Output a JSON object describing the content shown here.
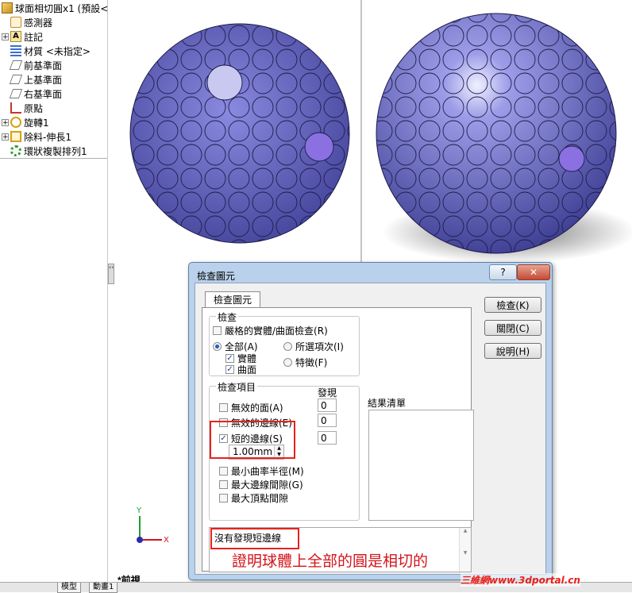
{
  "tree": {
    "items": [
      {
        "label": "球面相切圓x1 (預設<",
        "expander": ""
      },
      {
        "label": "感測器",
        "expander": ""
      },
      {
        "label": "註記",
        "expander": "+"
      },
      {
        "label": "材質 <未指定>",
        "expander": ""
      },
      {
        "label": "前基準面",
        "expander": ""
      },
      {
        "label": "上基準面",
        "expander": ""
      },
      {
        "label": "右基準面",
        "expander": ""
      },
      {
        "label": "原點",
        "expander": ""
      },
      {
        "label": "旋轉1",
        "expander": "+"
      },
      {
        "label": "除料-伸長1",
        "expander": "+"
      },
      {
        "label": "環狀複製排列1",
        "expander": ""
      }
    ],
    "bottom_tabs": [
      "模型",
      "動畫1"
    ]
  },
  "view": {
    "label": "*前視",
    "triad": {
      "x": "X",
      "y": "Y"
    },
    "sphere_color": "#5a5ab4",
    "sphere_highlight": "#c8c8f0"
  },
  "dialog": {
    "title": "檢查圖元",
    "help": "?",
    "close": "✕",
    "tab": "檢查圖元",
    "check_group": {
      "title": "檢查",
      "strict": {
        "label": "嚴格的實體/曲面檢查(R)",
        "checked": false
      },
      "all": {
        "label": "全部(A)",
        "selected": true
      },
      "solid": {
        "label": "實體",
        "checked": true
      },
      "surface": {
        "label": "曲面",
        "checked": true
      },
      "selected_items": {
        "label": "所選項次(I)",
        "selected": false
      },
      "feature": {
        "label": "特徵(F)",
        "selected": false
      }
    },
    "items_group": {
      "title": "檢查項目",
      "found_header": "發現",
      "items": [
        {
          "label": "無效的面(A)",
          "checked": false,
          "found": "0"
        },
        {
          "label": "無效的邊線(E)",
          "checked": false,
          "found": "0"
        },
        {
          "label": "短的邊線(S)",
          "checked": true,
          "found": "0"
        },
        {
          "label": "最小曲率半徑(M)",
          "checked": false
        },
        {
          "label": "最大邊線間隙(G)",
          "checked": false
        },
        {
          "label": "最大頂點間隙",
          "checked": false
        }
      ],
      "short_edge_value": "1.00mm"
    },
    "results_title": "結果清單",
    "status_text": "沒有發現短邊線",
    "annotation": "證明球體上全部的圓是相切的",
    "buttons": {
      "check": "檢查(K)",
      "close": "關閉(C)",
      "help": "說明(H)"
    }
  },
  "watermark": "三維網www.3dportal.cn",
  "colors": {
    "accent_red": "#e8211c",
    "dialog_frame": "#b9d1ea"
  }
}
